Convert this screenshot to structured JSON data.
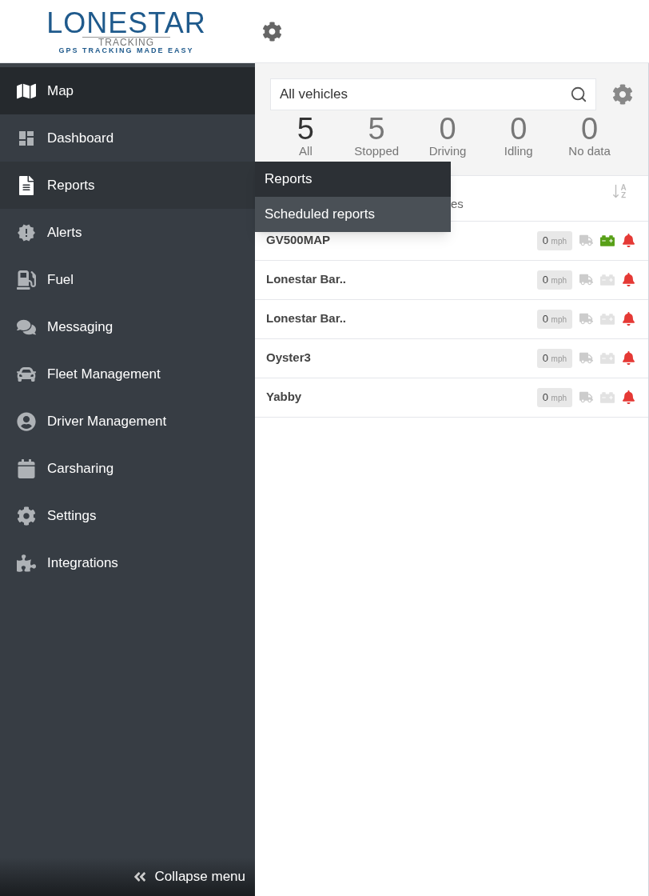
{
  "logo": {
    "name": "LONESTAR",
    "sub": "TRACKING",
    "tagline": "GPS TRACKING MADE EASY"
  },
  "sidebar": {
    "items": [
      {
        "label": "Map",
        "selected": true,
        "expanded": false
      },
      {
        "label": "Dashboard",
        "selected": false,
        "expanded": false
      },
      {
        "label": "Reports",
        "selected": false,
        "expanded": true
      },
      {
        "label": "Alerts",
        "selected": false,
        "expanded": false
      },
      {
        "label": "Fuel",
        "selected": false,
        "expanded": false
      },
      {
        "label": "Messaging",
        "selected": false,
        "expanded": false
      },
      {
        "label": "Fleet Management",
        "selected": false,
        "expanded": false
      },
      {
        "label": "Driver Management",
        "selected": false,
        "expanded": false
      },
      {
        "label": "Carsharing",
        "selected": false,
        "expanded": false
      },
      {
        "label": "Settings",
        "selected": false,
        "expanded": false
      },
      {
        "label": "Integrations",
        "selected": false,
        "expanded": false
      }
    ],
    "collapse": "Collapse menu"
  },
  "submenu": [
    {
      "label": "Reports",
      "selected": false
    },
    {
      "label": "Scheduled reports",
      "selected": true
    }
  ],
  "search": {
    "value": "All vehicles"
  },
  "stats": [
    {
      "count": "5",
      "label": "All",
      "selected": true
    },
    {
      "count": "5",
      "label": "Stopped",
      "selected": false
    },
    {
      "count": "0",
      "label": "Driving",
      "selected": false
    },
    {
      "count": "0",
      "label": "Idling",
      "selected": false
    },
    {
      "count": "0",
      "label": "No data",
      "selected": false
    }
  ],
  "list_header": {
    "label": "es"
  },
  "vehicles": [
    {
      "name": "GV500MAP",
      "speed": "0",
      "unit": "mph",
      "battery": true
    },
    {
      "name": "Lonestar Bar..",
      "speed": "0",
      "unit": "mph",
      "battery": false
    },
    {
      "name": "Lonestar Bar..",
      "speed": "0",
      "unit": "mph",
      "battery": false
    },
    {
      "name": "Oyster3",
      "speed": "0",
      "unit": "mph",
      "battery": false
    },
    {
      "name": "Yabby",
      "speed": "0",
      "unit": "mph",
      "battery": false
    }
  ]
}
